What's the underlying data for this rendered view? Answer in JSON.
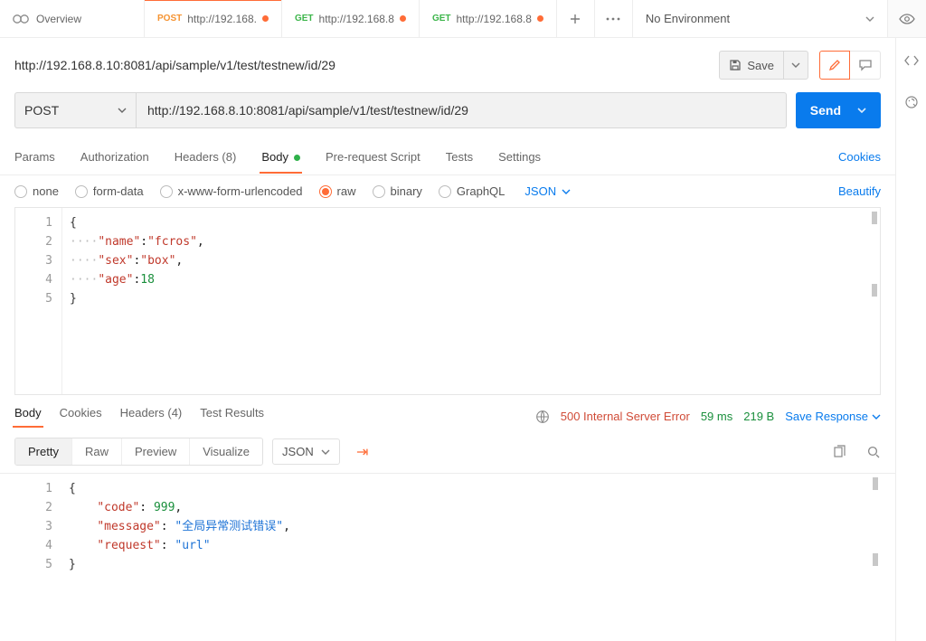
{
  "topTabs": {
    "overview": "Overview",
    "t1": {
      "method": "POST",
      "label": "http://192.168."
    },
    "t2": {
      "method": "GET",
      "label": "http://192.168.8"
    },
    "t3": {
      "method": "GET",
      "label": "http://192.168.8"
    }
  },
  "environment": "No Environment",
  "request": {
    "title": "http://192.168.8.10:8081/api/sample/v1/test/testnew/id/29",
    "saveLabel": "Save",
    "method": "POST",
    "url": "http://192.168.8.10:8081/api/sample/v1/test/testnew/id/29",
    "sendLabel": "Send"
  },
  "reqTabs": {
    "params": "Params",
    "auth": "Authorization",
    "headers": "Headers (8)",
    "body": "Body",
    "prereq": "Pre-request Script",
    "tests": "Tests",
    "settings": "Settings",
    "cookies": "Cookies"
  },
  "bodyTypes": {
    "none": "none",
    "form": "form-data",
    "xform": "x-www-form-urlencoded",
    "raw": "raw",
    "binary": "binary",
    "graphql": "GraphQL",
    "lang": "JSON",
    "beautify": "Beautify"
  },
  "reqBody": {
    "l1": "{",
    "l2_key": "\"name\"",
    "l2_val": "\"fcros\"",
    "l3_key": "\"sex\"",
    "l3_val": "\"box\"",
    "l4_key": "\"age\"",
    "l4_val": "18",
    "l5": "}"
  },
  "respTabs": {
    "body": "Body",
    "cookies": "Cookies",
    "headers": "Headers (4)",
    "results": "Test Results"
  },
  "respStatus": {
    "code": "500 Internal Server Error",
    "time": "59 ms",
    "size": "219 B",
    "save": "Save Response"
  },
  "respToolbar": {
    "pretty": "Pretty",
    "raw": "Raw",
    "preview": "Preview",
    "visualize": "Visualize",
    "lang": "JSON"
  },
  "respBody": {
    "l1": "{",
    "l2_key": "\"code\"",
    "l2_val": "999",
    "l3_key": "\"message\"",
    "l3_val": "\"全局异常测试错误\"",
    "l4_key": "\"request\"",
    "l4_val": "\"url\"",
    "l5": "}"
  }
}
